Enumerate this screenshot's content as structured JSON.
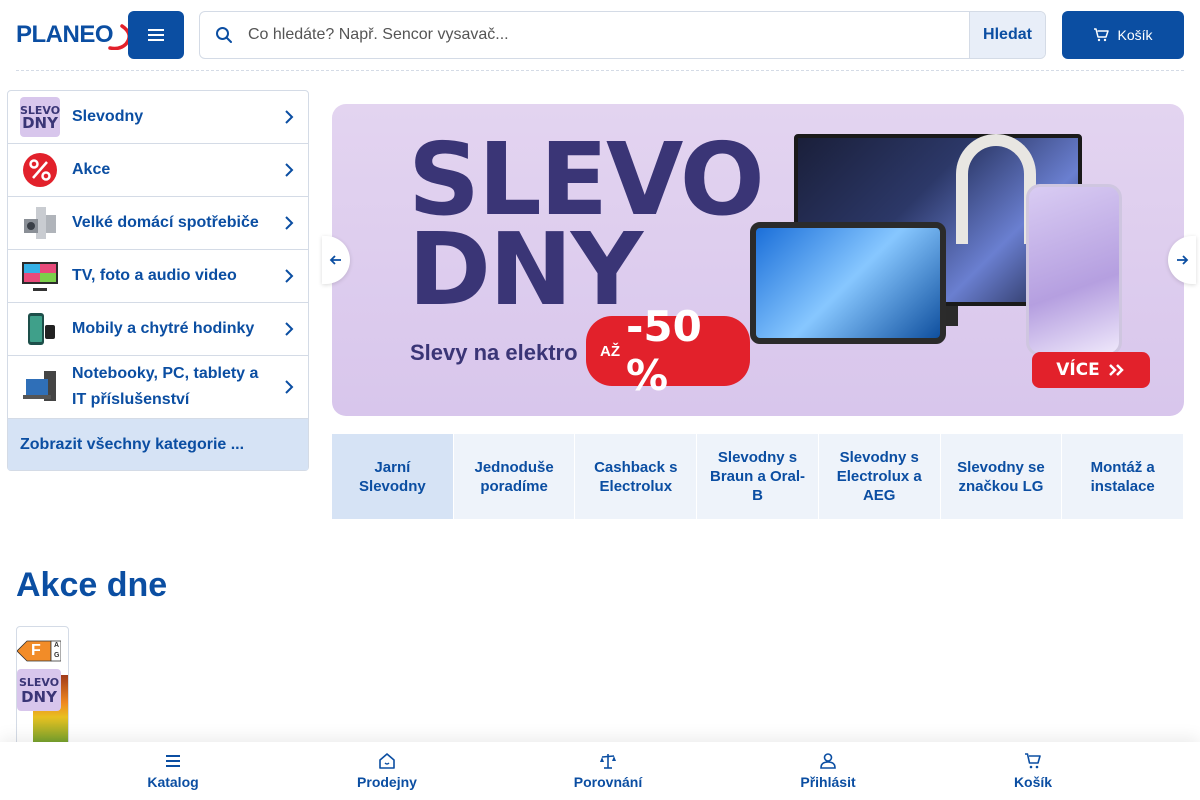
{
  "header": {
    "logo": "PLANEO",
    "search_placeholder": "Co hledáte? Např. Sencor vysavač...",
    "search_button": "Hledat",
    "cart_label": "Košík"
  },
  "sidebar": {
    "categories": [
      {
        "label": "Slevodny",
        "icon": "slevodny-icon"
      },
      {
        "label": "Akce",
        "icon": "percent-icon"
      },
      {
        "label": "Velké domácí spotřebiče",
        "icon": "appliance-icon"
      },
      {
        "label": "TV, foto a audio video",
        "icon": "tv-icon"
      },
      {
        "label": "Mobily a chytré hodinky",
        "icon": "phone-icon"
      },
      {
        "label": "Notebooky, PC, tablety a IT příslušenství",
        "icon": "laptop-icon"
      }
    ],
    "show_all": "Zobrazit všechny kategorie ..."
  },
  "banner": {
    "line1": "SLEVO",
    "line2": "DNY",
    "subtitle": "Slevy na elektro",
    "badge_prefix": "AŽ",
    "badge_value": "-50 %",
    "cta": "VÍCE",
    "brand_color": "#e2212b",
    "background_color": "#e3d4f0"
  },
  "tabs": [
    {
      "label": "Jarní Slevodny",
      "active": true
    },
    {
      "label": "Jednoduše poradíme",
      "active": false
    },
    {
      "label": "Cashback s Electrolux",
      "active": false
    },
    {
      "label": "Slevodny s Braun a Oral-B",
      "active": false
    },
    {
      "label": "Slevodny s Electrolux a AEG",
      "active": false
    },
    {
      "label": "Slevodny se značkou LG",
      "active": false
    },
    {
      "label": "Montáž a instalace",
      "active": false
    }
  ],
  "deals": {
    "title": "Akce dne",
    "energy_class": "F",
    "energy_scale_top": "A",
    "energy_scale_bottom": "G",
    "badge_line1": "SLEVO",
    "badge_line2": "DNY"
  },
  "bottom_nav": [
    {
      "label": "Katalog",
      "icon": "menu-icon"
    },
    {
      "label": "Prodejny",
      "icon": "home-icon"
    },
    {
      "label": "Porovnání",
      "icon": "scale-icon"
    },
    {
      "label": "Přihlásit",
      "icon": "user-icon"
    },
    {
      "label": "Košík",
      "icon": "cart-icon"
    }
  ],
  "colors": {
    "primary": "#0b4ea2",
    "light_blue": "#d6e3f5",
    "tab_bg": "#eef3fa"
  }
}
